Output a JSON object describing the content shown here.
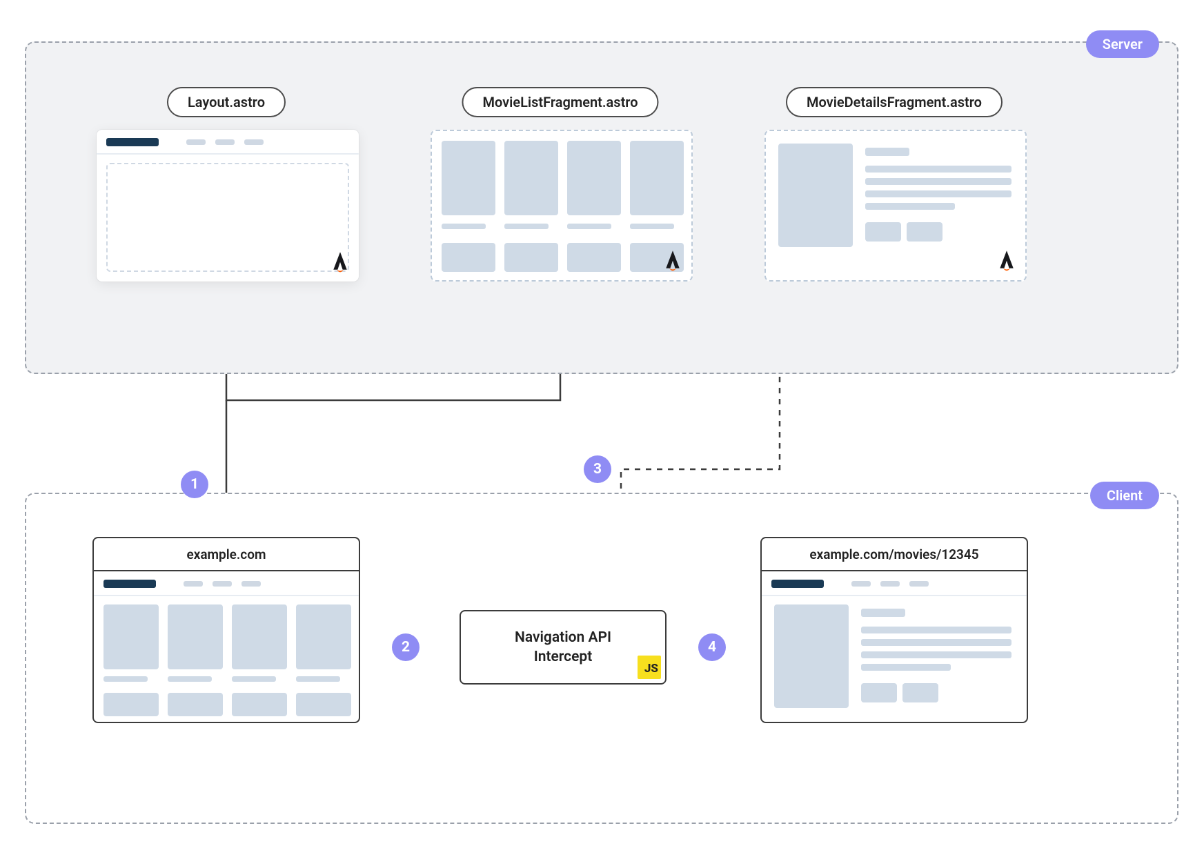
{
  "regions": {
    "server": {
      "label": "Server"
    },
    "client": {
      "label": "Client"
    }
  },
  "server_cards": {
    "layout": {
      "label": "Layout.astro"
    },
    "list": {
      "label": "MovieListFragment.astro"
    },
    "details": {
      "label": "MovieDetailsFragment.astro"
    }
  },
  "client_cards": {
    "home": {
      "url": "example.com"
    },
    "details": {
      "url": "example.com/movies/12345"
    }
  },
  "nav_box": {
    "line1": "Navigation API",
    "line2": "Intercept",
    "badge": "JS"
  },
  "steps": {
    "s1": "1",
    "s2": "2",
    "s3": "3",
    "s4": "4"
  },
  "colors": {
    "accent": "#8f8cf4",
    "wire_dark": "#1a3a55",
    "wire_light": "#cfdae6",
    "stroke": "#3b3b3b",
    "js": "#f7df1e"
  }
}
